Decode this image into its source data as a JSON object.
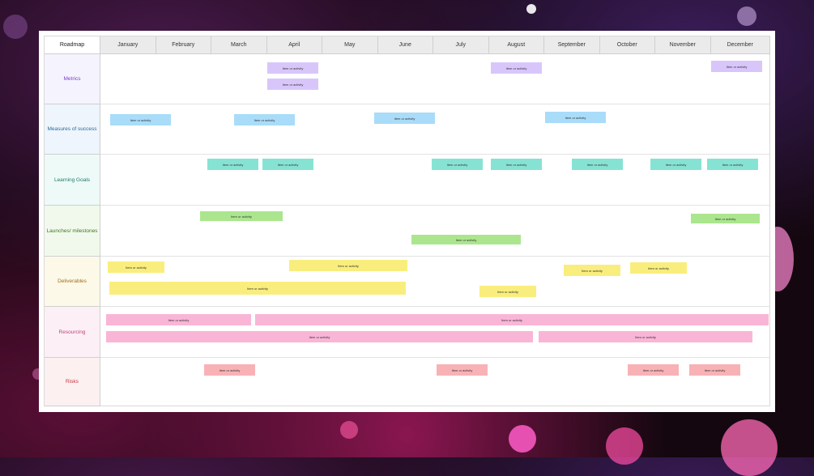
{
  "roadmap": {
    "corner_label": "Roadmap",
    "months": [
      "January",
      "February",
      "March",
      "April",
      "May",
      "June",
      "July",
      "August",
      "September",
      "October",
      "November",
      "December"
    ],
    "rows": [
      {
        "label": "Metrics",
        "color": "#7b3fc9",
        "bg": "#f5f3fe"
      },
      {
        "label": "Measures of success",
        "color": "#2b6a9e",
        "bg": "#eef5fc"
      },
      {
        "label": "Learning Goals",
        "color": "#1f7a6c",
        "bg": "#eefaf7"
      },
      {
        "label": "Launches/ milestones",
        "color": "#3b7a1f",
        "bg": "#f1f9ec"
      },
      {
        "label": "Deliverables",
        "color": "#a0701a",
        "bg": "#fcf9e8"
      },
      {
        "label": "Resourcing",
        "color": "#c4417c",
        "bg": "#fcf0f6"
      },
      {
        "label": "Risks",
        "color": "#c2333f",
        "bg": "#fdf0f0"
      }
    ],
    "item_label": "Item or activity"
  }
}
